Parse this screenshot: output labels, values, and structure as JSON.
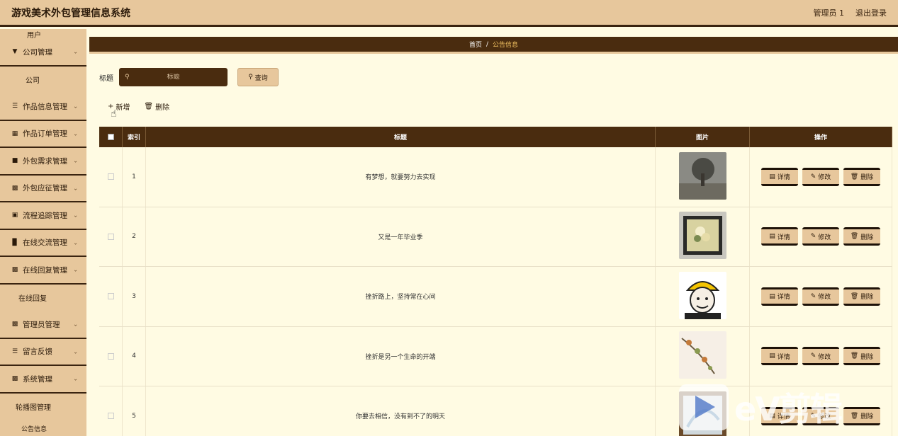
{
  "header": {
    "title": "游戏美术外包管理信息系统",
    "user": "管理员 1",
    "logout": "退出登录"
  },
  "sidebar": {
    "items": [
      {
        "label": "用户",
        "type": "sub",
        "icon": ""
      },
      {
        "label": "公司管理",
        "type": "group",
        "icon": "cup-icon"
      },
      {
        "label": "公司",
        "type": "sub",
        "icon": ""
      },
      {
        "label": "作品信息管理",
        "type": "group",
        "icon": "menu-icon"
      },
      {
        "label": "作品订单管理",
        "type": "group",
        "icon": "grid-icon"
      },
      {
        "label": "外包需求管理",
        "type": "group",
        "icon": "monitor-icon"
      },
      {
        "label": "外包应征管理",
        "type": "group",
        "icon": "apps-icon"
      },
      {
        "label": "流程追踪管理",
        "type": "group",
        "icon": "stack-icon"
      },
      {
        "label": "在线交流管理",
        "type": "group",
        "icon": "bar-chart-icon"
      },
      {
        "label": "在线回复管理",
        "type": "group",
        "icon": "apps-icon"
      },
      {
        "label": "在线回复",
        "type": "sub",
        "icon": ""
      },
      {
        "label": "管理员管理",
        "type": "group",
        "icon": "apps-icon"
      },
      {
        "label": "留言反馈",
        "type": "group",
        "icon": "menu-icon"
      },
      {
        "label": "系统管理",
        "type": "group",
        "icon": "apps-icon"
      },
      {
        "label": "轮播图管理",
        "type": "sub",
        "icon": ""
      },
      {
        "label": "公告信息",
        "type": "sub",
        "icon": ""
      }
    ]
  },
  "breadcrumb": {
    "home": "首页",
    "sep": "/",
    "current": "公告信息"
  },
  "search": {
    "label": "标题",
    "placeholder": "标题",
    "button": "查询"
  },
  "actions": {
    "add": "新增",
    "delete": "删除"
  },
  "table": {
    "headers": {
      "index": "索引",
      "title": "标题",
      "image": "图片",
      "ops": "操作"
    },
    "ops": {
      "detail": "详情",
      "edit": "修改",
      "delete": "删除"
    },
    "rows": [
      {
        "index": "1",
        "title": "有梦想，就要努力去实现"
      },
      {
        "index": "2",
        "title": "又是一年毕业季"
      },
      {
        "index": "3",
        "title": "挫折路上，坚持常在心间"
      },
      {
        "index": "4",
        "title": "挫折是另一个生命的开端"
      },
      {
        "index": "5",
        "title": "你要去相信，没有到不了的明天"
      }
    ]
  },
  "watermark": {
    "text": "eV剪辑"
  }
}
